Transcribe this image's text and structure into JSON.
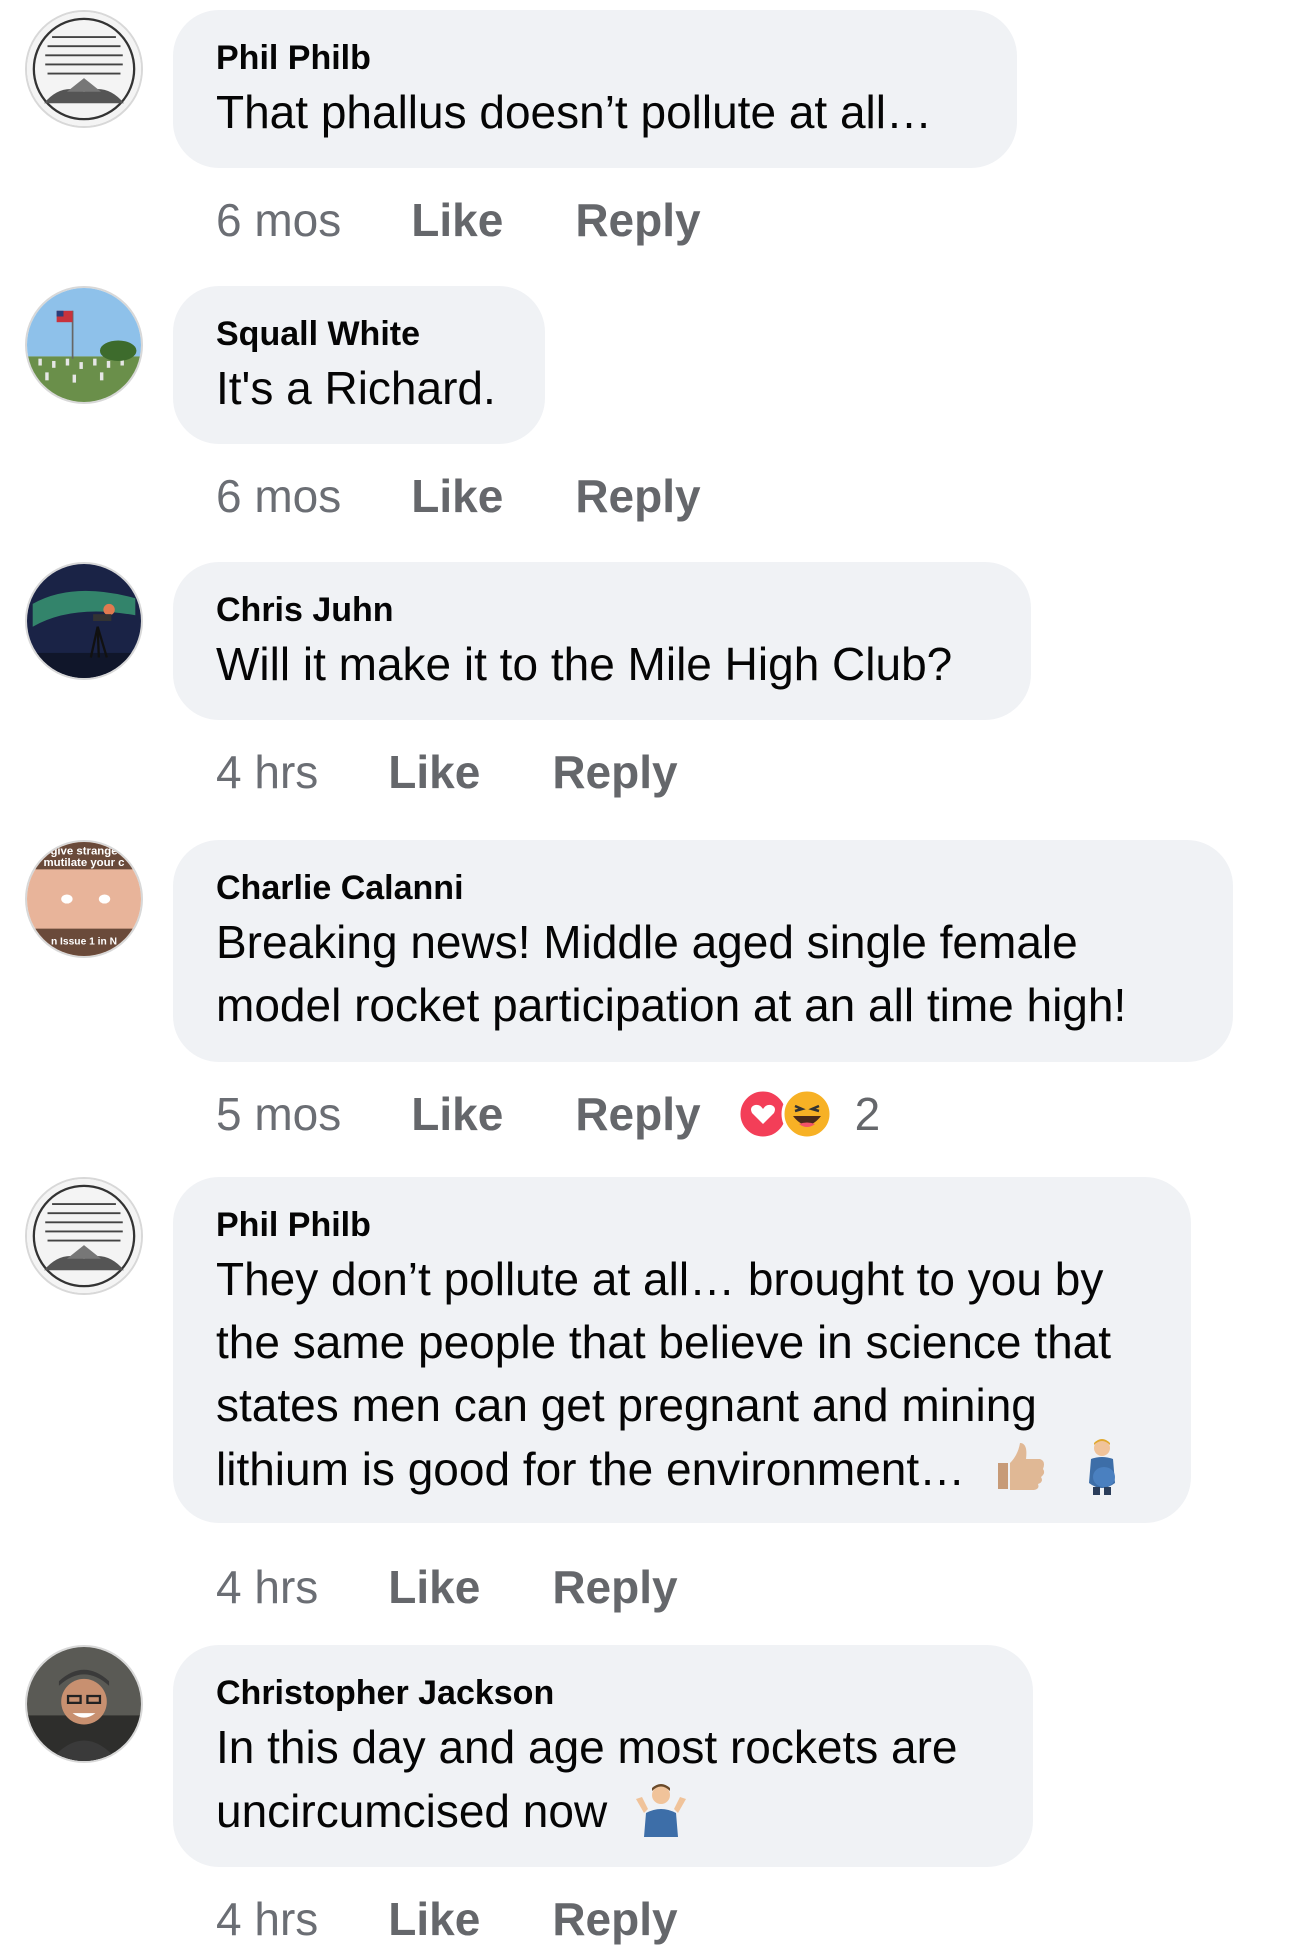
{
  "comments": [
    {
      "author": "Phil Philb",
      "lines": [
        "That phallus doesn’t pollute at all…"
      ],
      "time": "6 mos",
      "like": "Like",
      "reply": "Reply"
    },
    {
      "author": "Squall White",
      "lines": [
        "It's a Richard."
      ],
      "time": "6 mos",
      "like": "Like",
      "reply": "Reply"
    },
    {
      "author": "Chris Juhn",
      "lines": [
        "Will it make it to the Mile High Club?"
      ],
      "time": "4 hrs",
      "like": "Like",
      "reply": "Reply"
    },
    {
      "author": "Charlie Calanni",
      "lines": [
        "Breaking news! Middle aged single female",
        "model rocket participation at an all time high!"
      ],
      "time": "5 mos",
      "like": "Like",
      "reply": "Reply",
      "reaction_count": "2",
      "reactions": [
        "heart-icon",
        "laughing-face-icon"
      ],
      "avatar_text": [
        "give strange",
        "mutilate your c",
        "n Issue 1 in N"
      ]
    },
    {
      "author": "Phil Philb",
      "lines": [
        "They don’t pollute at all… brought to you by",
        "the same people that believe in science that",
        "states men can get pregnant and mining",
        "lithium is good for the environment…"
      ],
      "time": "4 hrs",
      "like": "Like",
      "reply": "Reply",
      "emojis": [
        "thumbs-up-icon",
        "pregnant-man-icon"
      ]
    },
    {
      "author": "Christopher Jackson",
      "lines": [
        "In this day and age most rockets are",
        "uncircumcised now"
      ],
      "time": "4 hrs",
      "like": "Like",
      "reply": "Reply",
      "emojis": [
        "shrugging-man-icon"
      ]
    }
  ],
  "colors": {
    "bubble": "#f0f2f5",
    "text": "#050505",
    "meta": "#65676b",
    "heart": "#f33e58",
    "haha": "#f7b125"
  }
}
